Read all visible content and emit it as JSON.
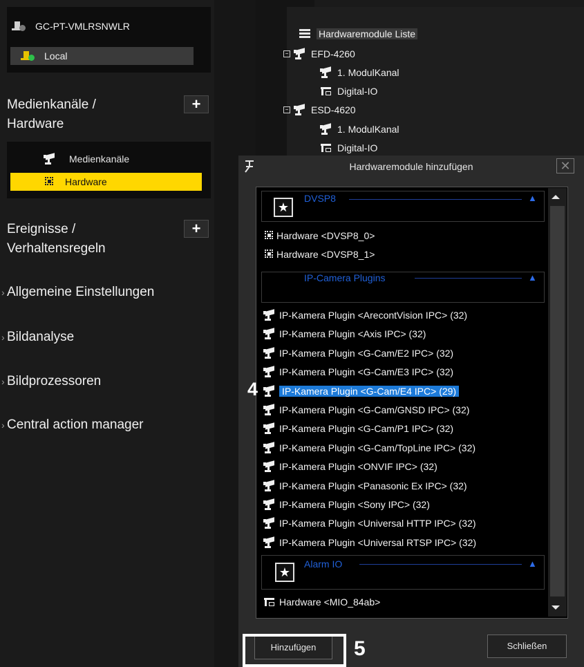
{
  "servers": [
    {
      "name": "GC-PT-VMLRSNWLR",
      "icon": "server-disconnected-icon"
    },
    {
      "name": "Local",
      "icon": "server-connected-icon"
    }
  ],
  "sidebar": {
    "media_section": {
      "label_line1": "Medienkanäle /",
      "label_line2": "Hardware",
      "plus": "+"
    },
    "media_items": [
      {
        "label": "Medienkanäle",
        "icon": "camera-icon"
      },
      {
        "label": "Hardware",
        "icon": "chip-icon"
      }
    ],
    "events_section": {
      "label_line1": "Ereignisse /",
      "label_line2": "Verhaltensregeln",
      "plus": "+"
    },
    "general_settings": "Allgemeine Einstellungen",
    "image_analysis": "Bildanalyse",
    "image_processors": "Bildprozessoren",
    "central_action_manager": "Central action manager"
  },
  "tree": {
    "root": "Hardwaremodule Liste",
    "modules": [
      {
        "name": "EFD-4260",
        "children": [
          "1. ModulKanal",
          "Digital-IO"
        ]
      },
      {
        "name": "ESD-4620",
        "children": [
          "1. ModulKanal",
          "Digital-IO"
        ]
      }
    ]
  },
  "dialog": {
    "title": "Hardwaremodule hinzufügen",
    "close": "✕",
    "groups": {
      "dvsp8": {
        "title": "DVSP8",
        "items": [
          "Hardware <DVSP8_0>",
          "Hardware <DVSP8_1>"
        ]
      },
      "ip_camera": {
        "title": "IP-Camera Plugins",
        "items": [
          "IP-Kamera Plugin <ArecontVision IPC> (32)",
          "IP-Kamera Plugin <Axis IPC> (32)",
          "IP-Kamera Plugin <G-Cam/E2 IPC> (32)",
          "IP-Kamera Plugin <G-Cam/E3 IPC> (32)",
          "IP-Kamera Plugin <G-Cam/E4 IPC> (29)",
          "IP-Kamera Plugin <G-Cam/GNSD IPC> (32)",
          "IP-Kamera Plugin <G-Cam/P1 IPC> (32)",
          "IP-Kamera Plugin <G-Cam/TopLine IPC> (32)",
          "IP-Kamera Plugin <ONVIF IPC> (32)",
          "IP-Kamera Plugin <Panasonic Ex IPC> (32)",
          "IP-Kamera Plugin <Sony IPC> (32)",
          "IP-Kamera Plugin <Universal HTTP IPC> (32)",
          "IP-Kamera Plugin <Universal RTSP IPC> (32)"
        ],
        "selected_index": 4
      },
      "alarm_io": {
        "title": "Alarm IO",
        "items": [
          "Hardware <MIO_84ab>"
        ]
      }
    },
    "add_button": "Hinzufügen",
    "close_button": "Schließen"
  },
  "annotations": {
    "step4": "4",
    "step5": "5"
  },
  "colors": {
    "selection_yellow": "#ffd700",
    "list_selection_blue": "#1d7ad8",
    "group_header_blue": "#2060d8"
  }
}
